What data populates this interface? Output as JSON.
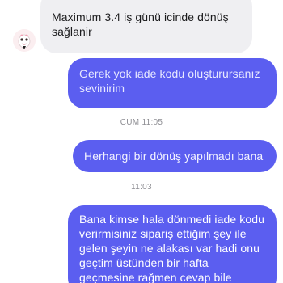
{
  "conversation": {
    "incoming": {
      "lines": [
        "Maximum 3.4 iş günü icinde dönüş",
        "sağlanir"
      ]
    },
    "outgoing_1": {
      "lines": [
        "Gerek yok iade kodu oluşturursanız",
        "sevinirim"
      ]
    },
    "timestamp_1": "CUM 11:05",
    "outgoing_2": {
      "lines": [
        "Herhangi bir dönüş yapılmadı bana"
      ]
    },
    "timestamp_2": "11:03",
    "outgoing_3": {
      "lines": [
        "Bana kimse hala dönmedi iade kodu",
        "verirmisiniz sipariş ettiğim şey ile",
        "gelen şeyin ne alakası var hadi onu",
        "geçtim üstünden bir hafta",
        "geçmesine rağmen cevap bile"
      ]
    }
  },
  "colors": {
    "outgoing_bubble": "#5b5ef0",
    "incoming_bubble": "#efeff2",
    "timestamp_text": "#8e8e93"
  },
  "icons": {
    "avatar": "sender-avatar-icon"
  }
}
